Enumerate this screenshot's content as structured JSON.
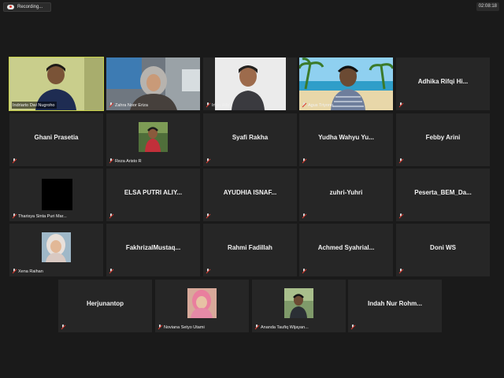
{
  "recording": {
    "label": "Recording..."
  },
  "meeting": {
    "timer": "02:08:18"
  },
  "colors": {
    "active_speaker": "#c8d14a",
    "tile_bg": "#262626",
    "muted_icon": "#d9362c"
  },
  "participants": {
    "p1": {
      "name": "Indriarto Dwi Nugroho"
    },
    "p2": {
      "name": "Zahra Noor Eriza"
    },
    "p3": {
      "name": "Irfan Rifa'i"
    },
    "p4": {
      "name": "Agus Triyono"
    },
    "p5": {
      "name": "Adhika  Rifqi  Hi..."
    },
    "p6": {
      "name": "Ghani Prasetia"
    },
    "p7": {
      "name": "Reza Aristo R"
    },
    "p8": {
      "name": "Syafi Rakha"
    },
    "p9": {
      "name": "Yudha  Wahyu  Yu..."
    },
    "p10": {
      "name": "Febby Arini"
    },
    "p11": {
      "name": "Tharisya Sinta Puri Mar..."
    },
    "p12": {
      "name": "ELSA  PUTRI  ALIY..."
    },
    "p13": {
      "name": "AYUDHIA  ISNAF..."
    },
    "p14": {
      "name": "zuhri-Yuhri"
    },
    "p15": {
      "name": "Peserta_BEM_Da..."
    },
    "p16": {
      "name": "Xena Raihan"
    },
    "p17": {
      "name": "FakhrizalMustaq..."
    },
    "p18": {
      "name": "Rahmi Fadillah"
    },
    "p19": {
      "name": "Achmed  Syahrial..."
    },
    "p20": {
      "name": "Doni WS"
    },
    "p21": {
      "name": "Herjunantop"
    },
    "p22": {
      "name": "Noviana Setyo Utami"
    },
    "p23": {
      "name": "Ananda Taufiq Wijayan..."
    },
    "p24": {
      "name": "Indah  Nur  Rohm..."
    }
  }
}
